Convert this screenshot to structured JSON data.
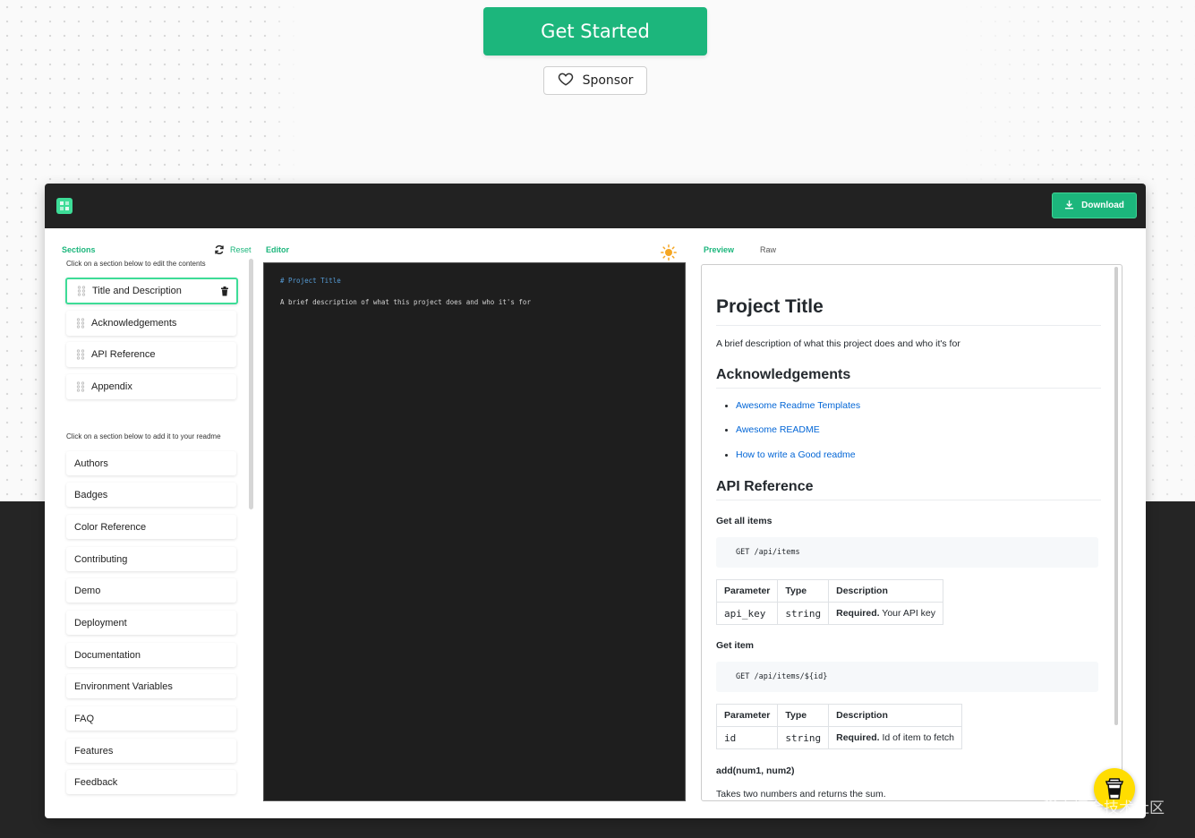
{
  "hero": {
    "get_started_label": "Get Started",
    "sponsor_label": "Sponsor"
  },
  "toolbar": {
    "download_label": "Download"
  },
  "sections": {
    "title": "Sections",
    "reset_label": "Reset",
    "edit_hint": "Click on a section below to edit the contents",
    "add_hint": "Click on a section below to add it to your readme",
    "selected": [
      {
        "label": "Title and Description"
      },
      {
        "label": "Acknowledgements"
      },
      {
        "label": "API Reference"
      },
      {
        "label": "Appendix"
      }
    ],
    "available": [
      {
        "label": "Authors"
      },
      {
        "label": "Badges"
      },
      {
        "label": "Color Reference"
      },
      {
        "label": "Contributing"
      },
      {
        "label": "Demo"
      },
      {
        "label": "Deployment"
      },
      {
        "label": "Documentation"
      },
      {
        "label": "Environment Variables"
      },
      {
        "label": "FAQ"
      },
      {
        "label": "Features"
      },
      {
        "label": "Feedback"
      }
    ]
  },
  "editor": {
    "title": "Editor",
    "line1": "# Project Title",
    "line2": "A brief description of what this project does and who it's for"
  },
  "preview": {
    "tab_preview": "Preview",
    "tab_raw": "Raw",
    "h1": "Project Title",
    "description": "A brief description of what this project does and who it's for",
    "ack_heading": "Acknowledgements",
    "ack_links": [
      "Awesome Readme Templates",
      "Awesome README",
      "How to write a Good readme"
    ],
    "api_heading": "API Reference",
    "get_all_title": "Get all items",
    "get_all_code": "GET /api/items",
    "table1": {
      "headers": [
        "Parameter",
        "Type",
        "Description"
      ],
      "param": "api_key",
      "type": "string",
      "desc_bold": "Required.",
      "desc_rest": " Your API key"
    },
    "get_item_title": "Get item",
    "get_item_code": "GET /api/items/${id}",
    "table2": {
      "headers": [
        "Parameter",
        "Type",
        "Description"
      ],
      "param": "id",
      "type": "string",
      "desc_bold": "Required.",
      "desc_rest": " Id of item to fetch"
    },
    "add_title": "add(num1, num2)",
    "add_desc": "Takes two numbers and returns the sum."
  },
  "watermark": "@稀土掘金技术社区",
  "colors": {
    "accent": "#1cb67c",
    "link": "#0366d6",
    "editor_bg": "#1e1e1e",
    "coffee": "#ffdd00"
  }
}
